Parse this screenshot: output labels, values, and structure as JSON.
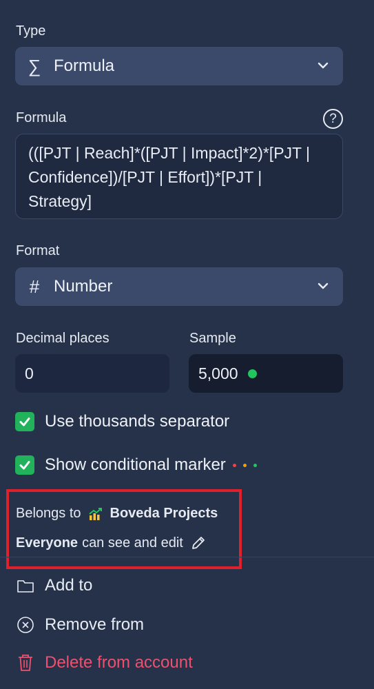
{
  "type": {
    "label": "Type",
    "value": "Formula",
    "icon": "sigma-icon"
  },
  "formula": {
    "label": "Formula",
    "help": "?",
    "lines": [
      "(([PJT | Reach]*([PJT | Impact]*2)*[PJT |",
      "Confidence])/[PJT | Effort])*[PJT |",
      "Strategy]"
    ]
  },
  "format": {
    "label": "Format",
    "value": "Number",
    "icon": "hash-icon"
  },
  "decimal": {
    "label": "Decimal places",
    "value": "0"
  },
  "sample": {
    "label": "Sample",
    "value": "5,000",
    "indicator_color": "#22c55e"
  },
  "options": {
    "thousands": {
      "label": "Use thousands separator",
      "checked": true
    },
    "marker": {
      "label": "Show conditional marker",
      "checked": true,
      "marker_colors": [
        "#ef4444",
        "#f59e0b",
        "#22c55e"
      ]
    }
  },
  "ownership": {
    "belongs_prefix": "Belongs to",
    "project": "Boveda Projects",
    "audience": "Everyone",
    "permission": "can see and edit"
  },
  "actions": {
    "add": "Add to",
    "remove": "Remove from",
    "delete": "Delete from account"
  },
  "colors": {
    "accent_check": "#22b25c",
    "danger": "#f0506e",
    "highlight": "#e0202b"
  }
}
